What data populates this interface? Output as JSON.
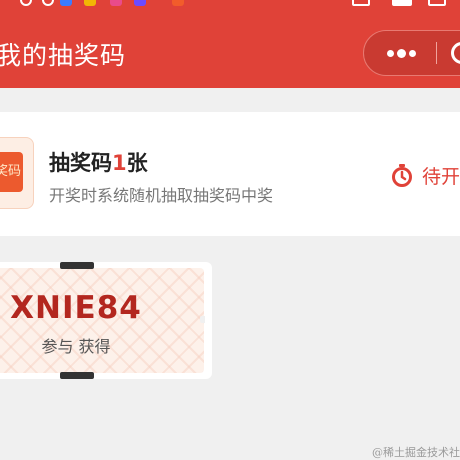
{
  "header": {
    "title": "我的抽奖码",
    "color": "#e04238"
  },
  "summary": {
    "thumb_label": "奖码",
    "title_prefix": "抽奖码",
    "count": "1",
    "title_suffix": "张",
    "subtitle": "开奖时系统随机抽取抽奖码中奖",
    "status": "待开"
  },
  "ticket": {
    "code": "XNIE84",
    "caption_a": "参与",
    "caption_b": "获得"
  },
  "watermark": "@稀土掘金技术社区",
  "icons": {
    "status_bar": [
      "notification-icon",
      "notification-icon",
      "app-icon",
      "app-icon"
    ],
    "menu": "more-dots-icon",
    "close": "close-target-icon",
    "timer": "stopwatch-icon"
  }
}
